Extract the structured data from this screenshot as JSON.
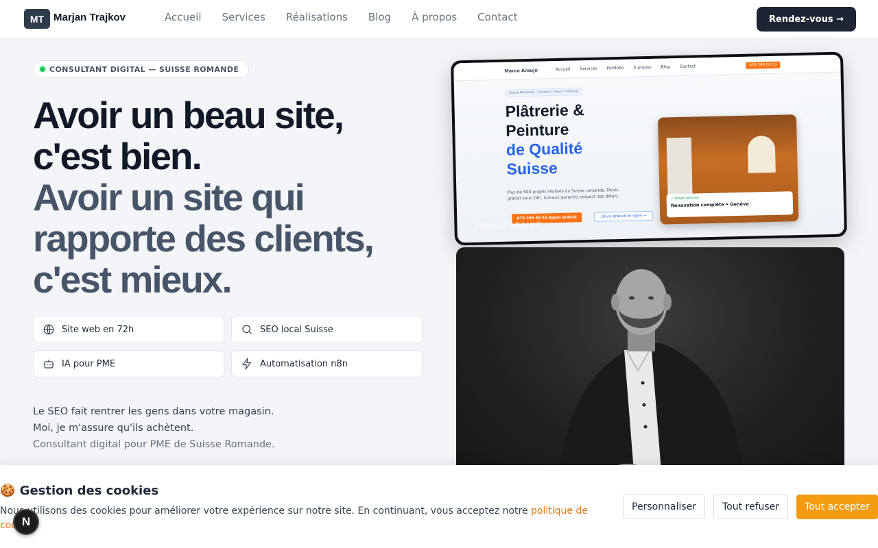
{
  "header": {
    "logo_initials": "MT",
    "logo_name": "Marjan Trajkov",
    "nav": [
      "Accueil",
      "Services",
      "Réalisations",
      "Blog",
      "À propos",
      "Contact"
    ],
    "cta_label": "Rendez-vous →"
  },
  "hero": {
    "pill_label": "CONSULTANT DIGITAL — SUISSE ROMANDE",
    "headline_dark": [
      "Avoir un beau site,",
      "c'est bien."
    ],
    "headline_muted": [
      "Avoir un site qui",
      "rapporte des clients,",
      "c'est mieux."
    ],
    "features": [
      {
        "icon": "globe-icon",
        "label": "Site web en 72h"
      },
      {
        "icon": "search-icon",
        "label": "SEO local Suisse"
      },
      {
        "icon": "bot-icon",
        "label": "IA pour PME"
      },
      {
        "icon": "lightning-icon",
        "label": "Automatisation n8n"
      }
    ],
    "tagline": [
      "Le SEO fait rentrer les gens dans votre magasin.",
      "Moi, je m'assure qu'ils achètent.",
      "Consultant digital pour PME de Suisse Romande."
    ]
  },
  "mockup": {
    "brand": "Marco Araujo",
    "nav": [
      "Accueil",
      "Services",
      "Portfolio",
      "À propos",
      "Blog",
      "Contact"
    ],
    "phone": "079 299 50 53",
    "badge": "Suisse Romande • Genève • Vaud • Fribourg",
    "title_lines": [
      "Plâtrerie &",
      "Peinture"
    ],
    "title_blue": [
      "de Qualité",
      "Suisse"
    ],
    "description": "Plus de 500 projets réalisés en Suisse romande. Devis gratuit sous 24h, travaux garantis, respect des délais.",
    "btn_call": "079 299 50 53 Appel gratuit",
    "btn_quote": "Devis gratuit en ligne →",
    "photo_tag": "✓ Projet terminé",
    "photo_caption": "Rénovation complète • Genève",
    "watermark": "MARCO ARAUJO"
  },
  "cookie": {
    "title": "🍪 Gestion des cookies",
    "text": "Nous utilisons des cookies pour améliorer votre expérience sur notre site. En continuant, vous acceptez notre ",
    "link": "politique de cookies",
    "buttons": {
      "customize": "Personnaliser",
      "refuse": "Tout refuser",
      "accept": "Tout accepter"
    }
  },
  "n_badge": "N",
  "colors": {
    "accent_orange": "#f39c12",
    "dark_navy": "#1e2433",
    "status_green": "#22c55e"
  }
}
